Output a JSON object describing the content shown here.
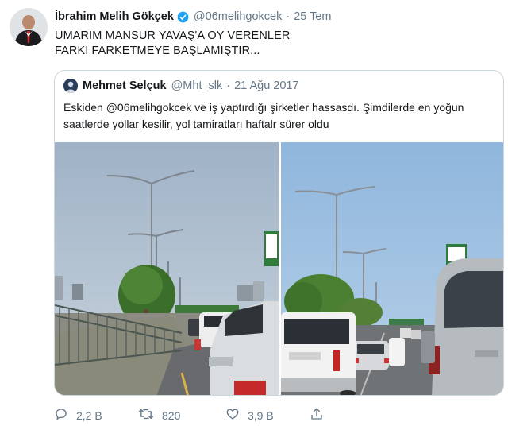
{
  "tweet": {
    "author_name": "İbrahim Melih Gökçek",
    "author_handle": "@06melihgokcek",
    "separator": "·",
    "time": "25 Tem",
    "text_lines": [
      "UMARIM MANSUR YAVAŞ'A OY VERENLER",
      "FARKI FARKETMEYE BAŞLAMIŞTIR..."
    ],
    "verified_icon": "verified-badge-icon"
  },
  "quote": {
    "author_name": "Mehmet Selçuk",
    "author_handle": "@Mht_slk",
    "separator": "·",
    "time": "21 Ağu 2017",
    "text_lines": [
      "Eskiden @06melihgokcek ve iş yaptırdığı şirketler hassasdı. Şimdilerde en yoğun",
      "saatlerde yollar kesilir, yol tamiratları haftalr sürer oldu"
    ]
  },
  "actions": {
    "reply_count": "2,2 B",
    "retweet_count": "820",
    "like_count": "3,9 B"
  },
  "colors": {
    "text": "#14171a",
    "muted": "#657786",
    "border": "#ccd6dd",
    "verified": "#1da1f2"
  }
}
